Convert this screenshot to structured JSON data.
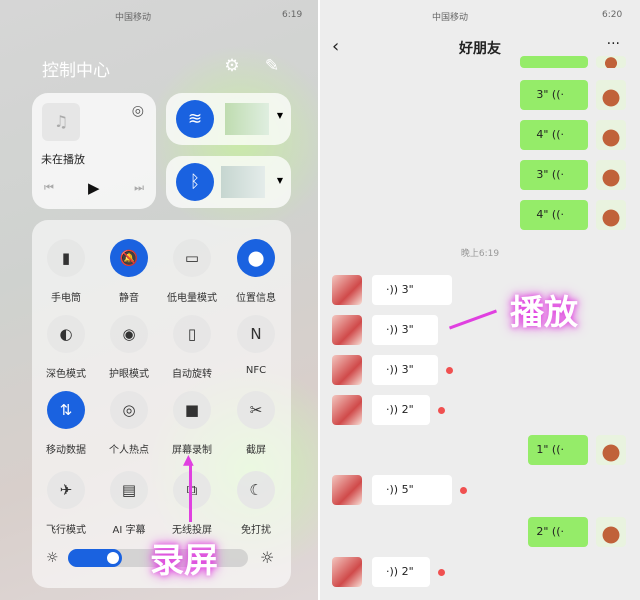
{
  "left": {
    "status_carrier": "中国移动",
    "status_time": "6:19",
    "title": "控制中心",
    "music": {
      "status": "未在播放"
    },
    "tiles": [
      {
        "label": "手电筒",
        "icon": "flashlight-icon",
        "on": false
      },
      {
        "label": "静音",
        "icon": "bell-off-icon",
        "on": true
      },
      {
        "label": "低电量模式",
        "icon": "battery-icon",
        "on": false
      },
      {
        "label": "位置信息",
        "icon": "location-icon",
        "on": true
      },
      {
        "label": "深色模式",
        "icon": "dark-mode-icon",
        "on": false
      },
      {
        "label": "护眼模式",
        "icon": "eye-icon",
        "on": false
      },
      {
        "label": "自动旋转",
        "icon": "rotate-icon",
        "on": false
      },
      {
        "label": "NFC",
        "icon": "nfc-icon",
        "on": false
      },
      {
        "label": "移动数据",
        "icon": "mobile-data-icon",
        "on": true
      },
      {
        "label": "个人热点",
        "icon": "hotspot-icon",
        "on": false
      },
      {
        "label": "屏幕录制",
        "icon": "screen-record-icon",
        "on": false
      },
      {
        "label": "截屏",
        "icon": "screenshot-icon",
        "on": false
      },
      {
        "label": "飞行模式",
        "icon": "airplane-icon",
        "on": false
      },
      {
        "label": "AI 字幕",
        "icon": "subtitle-icon",
        "on": false
      },
      {
        "label": "无线投屏",
        "icon": "cast-icon",
        "on": false
      },
      {
        "label": "免打扰",
        "icon": "moon-icon",
        "on": false
      }
    ],
    "brightness": 0.3,
    "overlay": "录屏"
  },
  "right": {
    "status_carrier": "中国移动",
    "status_time": "6:20",
    "chat_title": "好朋友",
    "timestamp": "晚上6:19",
    "overlay": "播放",
    "messages": [
      {
        "side": "sent",
        "text": "3\""
      },
      {
        "side": "sent",
        "text": "4\""
      },
      {
        "side": "sent",
        "text": "3\""
      },
      {
        "side": "sent",
        "text": "4\""
      },
      {
        "side": "recv",
        "text": "3\"",
        "unread": false
      },
      {
        "side": "recv",
        "text": "3\"",
        "unread": false
      },
      {
        "side": "recv",
        "text": "3\"",
        "unread": true
      },
      {
        "side": "recv",
        "text": "2\"",
        "unread": true
      },
      {
        "side": "sent",
        "text": "1\""
      },
      {
        "side": "recv",
        "text": "5\"",
        "unread": true
      },
      {
        "side": "sent",
        "text": "2\""
      },
      {
        "side": "recv",
        "text": "2\"",
        "unread": true
      }
    ]
  },
  "colors": {
    "accent": "#1a62e0",
    "bubble": "#95ec69",
    "overlay_glow": "#e040e0"
  }
}
